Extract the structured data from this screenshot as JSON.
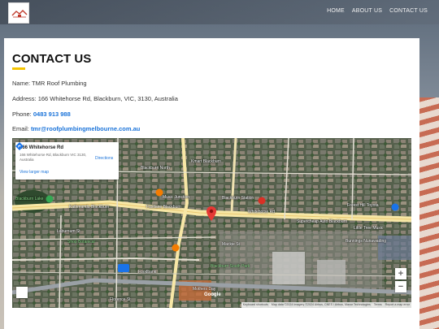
{
  "nav": {
    "home": "HOME",
    "about": "ABOUT US",
    "contact": "CONTACT US"
  },
  "page": {
    "title": "CONTACT US"
  },
  "contact": {
    "name_label": "Name:",
    "name_value": "TMR Roof Plumbing",
    "address_label": "Address:",
    "address_value": "166 Whitehorse Rd, Blackburn, VIC, 3130, Australia",
    "phone_label": "Phone:",
    "phone_value": "0483 913 988",
    "email_label": "Email:",
    "email_value": "tmr@roofplumbingmelbourne.com.au"
  },
  "map": {
    "card_title": "166 Whitehorse Rd",
    "card_address": "166 Whitehorse Rd, Blackburn VIC 3130, Australia",
    "directions": "Directions",
    "larger_map": "View larger map",
    "zoom_in": "+",
    "zoom_out": "−",
    "google": "Google",
    "attribution": {
      "shortcuts": "Keyboard shortcuts",
      "data": "Map data ©2024 Imagery ©2024 Airbus, CNES / Airbus, Maxar Technologies",
      "terms": "Terms",
      "report": "Report a map error"
    },
    "places": [
      {
        "label": "Blackburn Lake",
        "green": true
      },
      {
        "label": "Kmart Blackburn",
        "green": false
      },
      {
        "label": "Blackburn North",
        "green": false
      },
      {
        "label": "Music Junction",
        "green": false
      },
      {
        "label": "Blackburn Station",
        "green": false
      },
      {
        "label": "Kathmandu Blackburn",
        "green": false
      },
      {
        "label": "Fastlane Blackburn",
        "green": false
      },
      {
        "label": "Supercheap Auto Blackburn",
        "green": false
      },
      {
        "label": "Forest Hill Toyota",
        "green": false
      },
      {
        "label": "Bunnings Nunawading",
        "green": false
      },
      {
        "label": "Little Tree Music",
        "green": false
      },
      {
        "label": "Laburnum St",
        "green": false
      },
      {
        "label": "Shop Botanical",
        "green": true
      },
      {
        "label": "Mackie St",
        "green": false
      },
      {
        "label": "Blackburn South Park",
        "green": true
      },
      {
        "label": "Foodbank",
        "green": false
      },
      {
        "label": "Mothers Day",
        "green": false
      },
      {
        "label": "Florence St",
        "green": false
      },
      {
        "label": "Whitehorse Rd",
        "green": false
      }
    ]
  }
}
